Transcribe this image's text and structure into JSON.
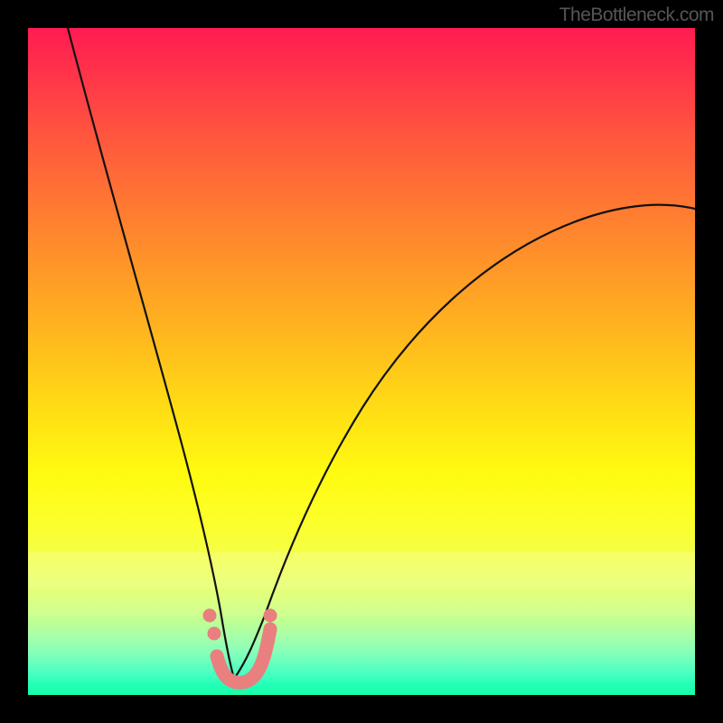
{
  "attribution": "TheBottleneck.com",
  "colors": {
    "frame": "#000000",
    "curve": "#111111",
    "marker": "#e97f7f"
  },
  "chart_data": {
    "type": "line",
    "title": "",
    "xlabel": "",
    "ylabel": "",
    "xlim": [
      0,
      100
    ],
    "ylim": [
      0,
      100
    ],
    "series": [
      {
        "name": "left-branch",
        "x": [
          6,
          10,
          14,
          18,
          20,
          22,
          24,
          25,
          26,
          27,
          28,
          29,
          30,
          31
        ],
        "y": [
          100,
          80,
          60,
          40,
          31,
          23,
          16.5,
          14,
          12,
          10.5,
          9,
          7.5,
          5.5,
          2.5
        ]
      },
      {
        "name": "right-branch",
        "x": [
          31,
          33,
          35,
          37,
          39,
          41,
          45,
          50,
          55,
          60,
          65,
          70,
          75,
          80,
          85,
          90,
          95,
          100
        ],
        "y": [
          2.5,
          3,
          5,
          9,
          13,
          17.5,
          26,
          34,
          41,
          47,
          52,
          56.5,
          60.5,
          64,
          67,
          69.5,
          71.5,
          73
        ]
      },
      {
        "name": "marker-segment",
        "x": [
          27.5,
          28.5,
          30,
          31,
          32.5,
          34,
          35.6,
          36.5
        ],
        "y": [
          12,
          6,
          3.5,
          2.5,
          2.6,
          3.5,
          5.5,
          12
        ]
      }
    ],
    "background_gradient": {
      "top": "red",
      "middle": "yellow",
      "bottom": "green"
    }
  }
}
